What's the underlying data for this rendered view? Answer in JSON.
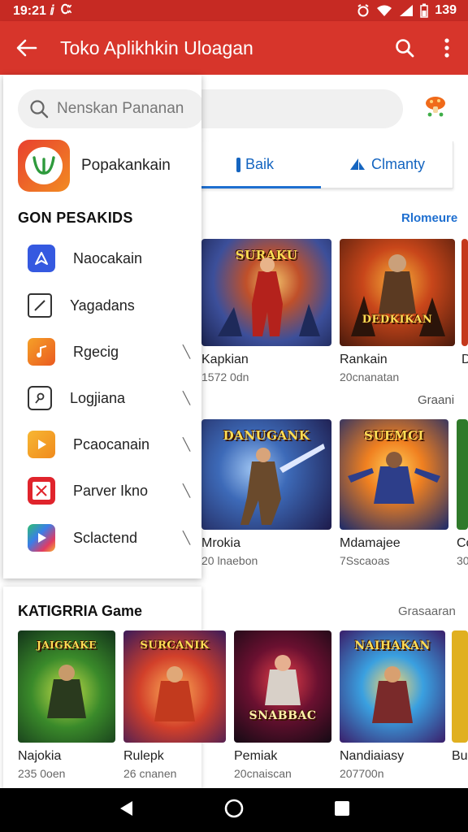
{
  "status_bar": {
    "time": "19:21 ⅈ",
    "extra_glyph": "Ꮸ",
    "battery_text": "139"
  },
  "app_bar": {
    "title": "Toko Aplikhkin Uloagan"
  },
  "search": {
    "placeholder": "Nenskan Pananan"
  },
  "tabs": [
    {
      "label": "Baik"
    },
    {
      "label": "Clmanty"
    }
  ],
  "section": {
    "more_label": "Rlomeure",
    "secondary_label": "Graani"
  },
  "drawer": {
    "app_name": "Popakankain",
    "heading": "GON PESAKIDS",
    "items": [
      {
        "label": "Naocakain",
        "has_arrow": false,
        "color": "#3559e0"
      },
      {
        "label": "Yagadans",
        "has_arrow": false,
        "color": "#222222"
      },
      {
        "label": "Rgecig",
        "has_arrow": true,
        "color": "#f07c24"
      },
      {
        "label": "Logjiana",
        "has_arrow": true,
        "color": "#222222"
      },
      {
        "label": "Pcaocanain",
        "has_arrow": true,
        "color": "#f0a020"
      },
      {
        "label": "Parver Ikno",
        "has_arrow": true,
        "color": "#e0242c"
      },
      {
        "label": "Sclactend",
        "has_arrow": true,
        "color": "#7b3fe4"
      }
    ]
  },
  "row1": [
    {
      "name": "Kapkian",
      "meta": "1572 0dn",
      "art": "SURAKU"
    },
    {
      "name": "Rankain",
      "meta": "20cnanatan",
      "art": "DEDKIKAN"
    },
    {
      "name": "D",
      "meta": ""
    }
  ],
  "row2": [
    {
      "name": "Mrokia",
      "meta": "20 lnaebon",
      "art": "DANUGANK"
    },
    {
      "name": "Mdamajee",
      "meta": "7Sscaoas",
      "art": "SUEMCI"
    },
    {
      "name": "Cc",
      "meta": "30"
    }
  ],
  "category": {
    "title": "KATIGRRIA Game",
    "more_label": "Grasaaran",
    "items": [
      {
        "name": "Najokia",
        "meta": "235 0oen",
        "art": "JAIGKAKE"
      },
      {
        "name": "Rulepk",
        "meta": "26 cnanen",
        "art": "SURCANIK"
      },
      {
        "name": "Pemiak",
        "meta": "20cnaiscan",
        "art": "SNABBAC"
      },
      {
        "name": "Nandiaiasy",
        "meta": "207700n",
        "art": "NAIHAKAN"
      },
      {
        "name": "Bu",
        "meta": ""
      }
    ]
  },
  "colors": {
    "brand": "#d7352b",
    "status": "#c62a23",
    "accent": "#1e6fd0"
  }
}
